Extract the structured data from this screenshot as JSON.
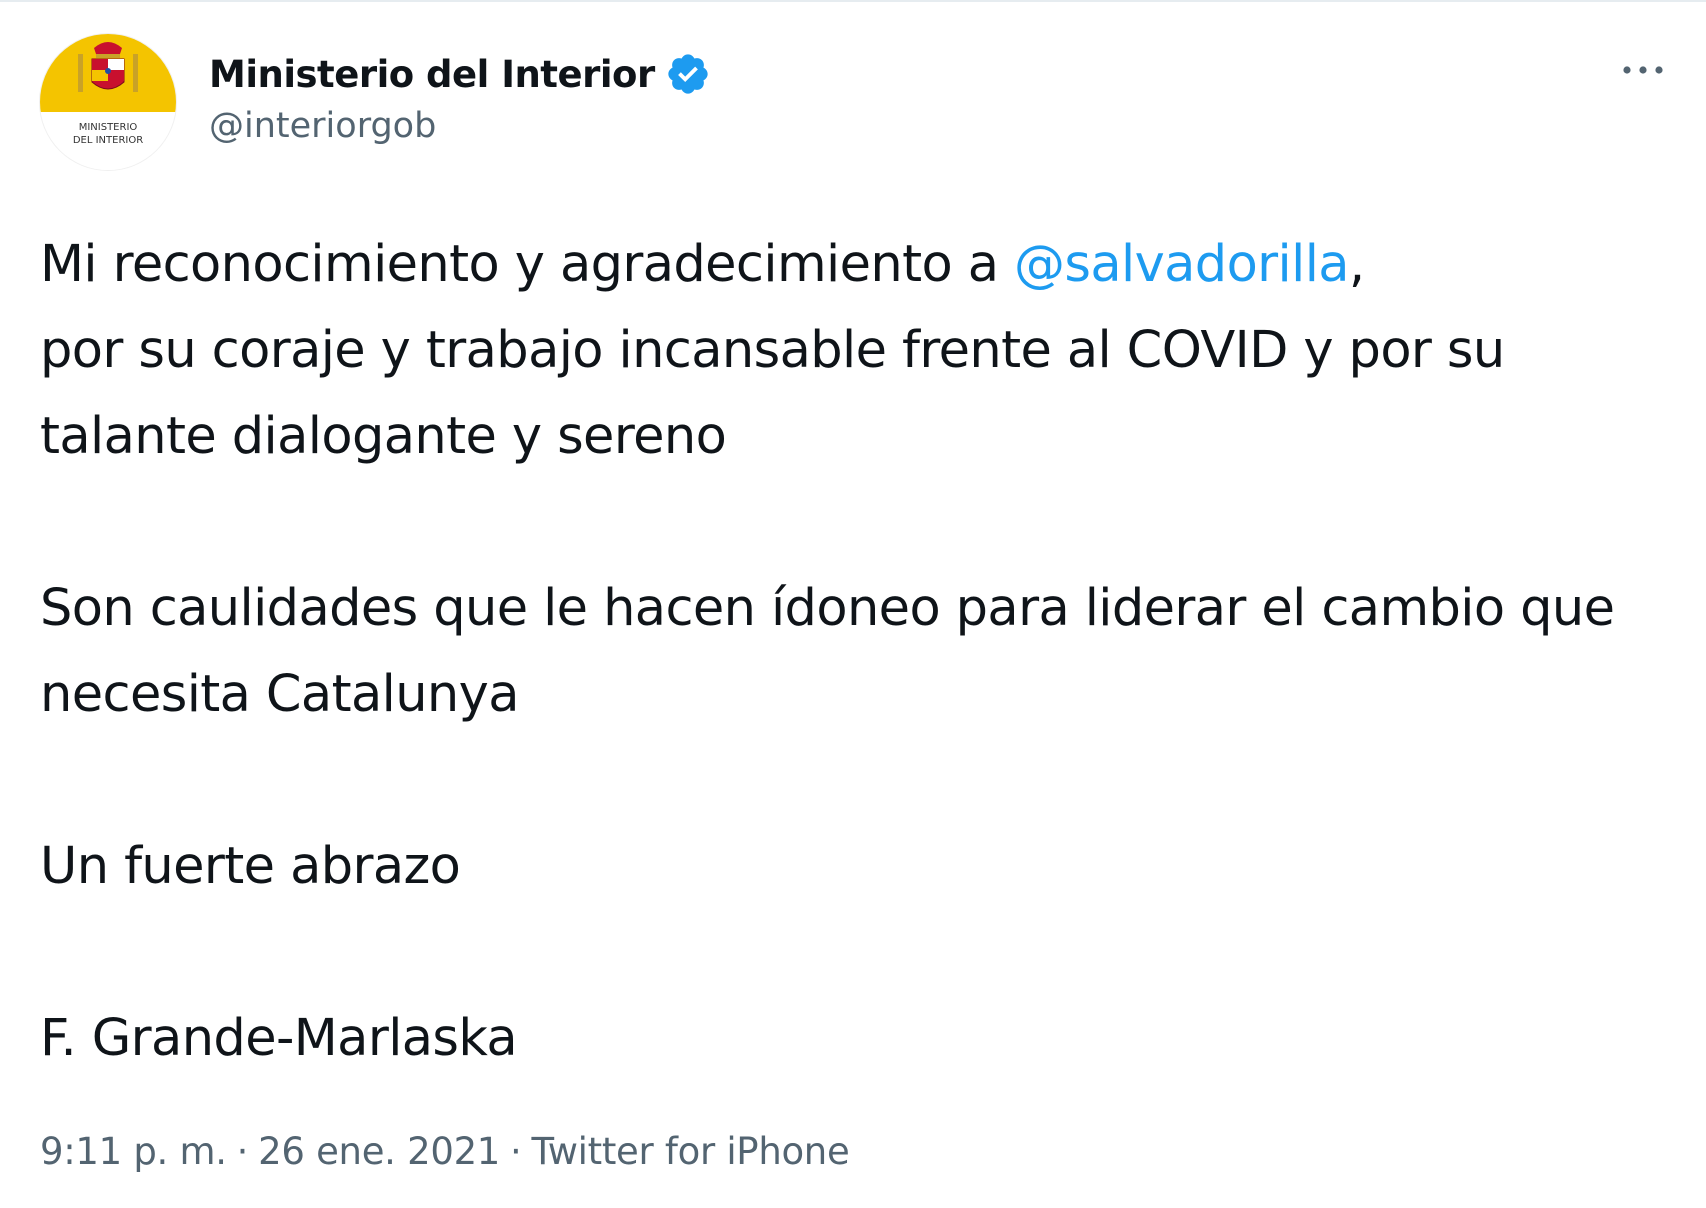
{
  "author": {
    "display_name": "Ministerio del Interior",
    "handle": "@interiorgob",
    "avatar_label_line1": "MINISTERIO",
    "avatar_label_line2": "DEL INTERIOR",
    "verified": true,
    "verified_color": "#1d9bf0"
  },
  "tweet": {
    "line1_before": "Mi reconocimiento y agradecimiento a ",
    "mention": "@salvadorilla",
    "line1_after": ",",
    "paragraph1_rest": "por su coraje y trabajo incansable frente al COVID y por su talante dialogante y sereno",
    "paragraph2": "Son caulidades que le hacen ídoneo para liderar el cambio que necesita Catalunya",
    "paragraph3": "Un fuerte abrazo",
    "paragraph4": "F. Grande-Marlaska"
  },
  "meta": {
    "time": "9:11 p. m.",
    "date": "26 ene. 2021",
    "separator": "·",
    "source": "Twitter for iPhone"
  },
  "icons": {
    "more": "more-horizontal-icon",
    "verified": "verified-badge-icon"
  },
  "colors": {
    "link": "#1d9bf0",
    "secondary_text": "#536471",
    "avatar_yellow": "#f4c400"
  }
}
